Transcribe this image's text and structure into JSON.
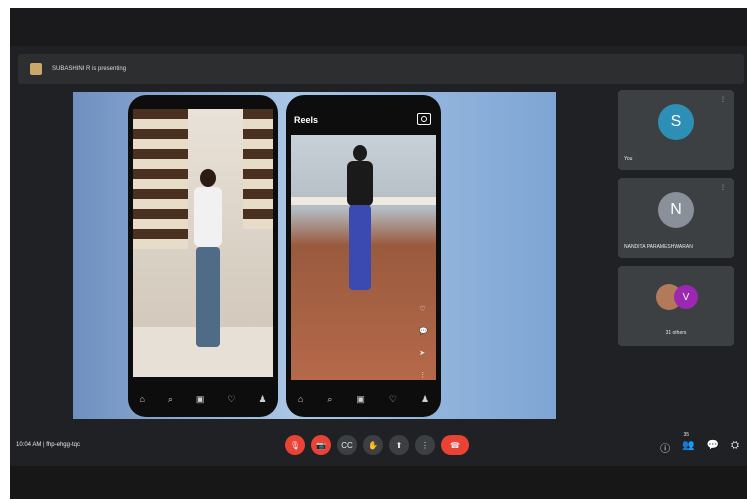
{
  "banner": {
    "text": "SUBASHINI R is presenting"
  },
  "phones": {
    "left": {
      "nav_icons": [
        "⌂",
        "⌕",
        "▣",
        "♡",
        "♟"
      ]
    },
    "right": {
      "label": "Reels",
      "side_icons": [
        "♡",
        "💬",
        "➤",
        "⋮"
      ],
      "nav_icons": [
        "⌂",
        "⌕",
        "▣",
        "♡",
        "♟"
      ]
    }
  },
  "participants": [
    {
      "initial": "S",
      "name": "You",
      "color": "#2d8fb5"
    },
    {
      "initial": "N",
      "name": "NANDITA PARAMESHWARAN",
      "color": "#8a9099"
    }
  ],
  "others": {
    "avatar_letter": "V",
    "label": "31 others"
  },
  "bottom": {
    "time": "10:04 AM",
    "separator": "|",
    "meeting_code": "fhp-ehgg-tqc",
    "controls": {
      "mic": "🎙",
      "cam": "📷",
      "captions": "CC",
      "hand": "✋",
      "present": "⬆",
      "more": "⋮",
      "end": "☎"
    },
    "participant_count": "35",
    "right_icons": {
      "info": "ⓘ",
      "people": "👥",
      "chat": "💬",
      "activities": "⛭"
    }
  }
}
